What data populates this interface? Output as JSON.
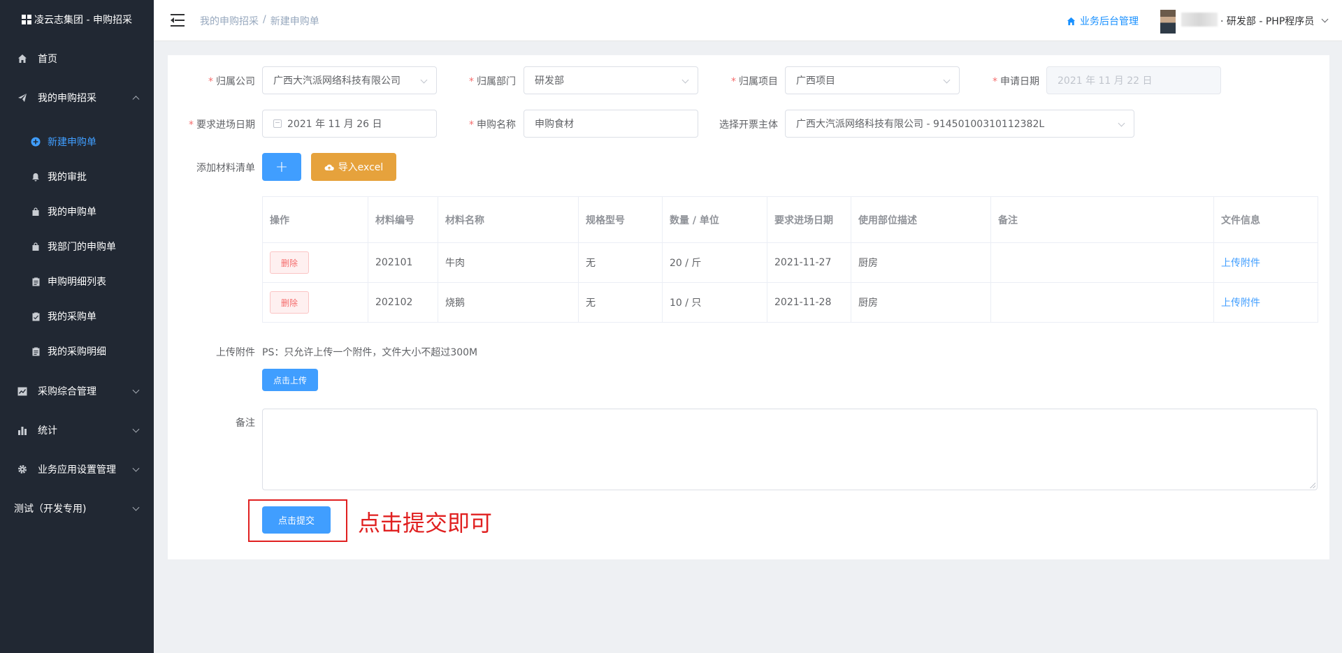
{
  "brand": {
    "title": "凌云志集团 - 申购招采"
  },
  "sidebar": {
    "home": "首页",
    "my_purchase": "我的申购招采",
    "sub_items": [
      "新建申购单",
      "我的审批",
      "我的申购单",
      "我部门的申购单",
      "申购明细列表",
      "我的采购单",
      "我的采购明细"
    ],
    "purchase_mgmt": "采购综合管理",
    "stats": "统计",
    "biz_settings": "业务应用设置管理",
    "test_dev": "测试（开发专用)"
  },
  "header": {
    "breadcrumb": [
      "我的申购招采",
      "/",
      "新建申购单"
    ],
    "biz_backend": "业务后台管理",
    "user_role": "· 研发部 - PHP程序员"
  },
  "form": {
    "company_label": "归属公司",
    "company_value": "广西大汽派网络科技有限公司",
    "dept_label": "归属部门",
    "dept_value": "研发部",
    "project_label": "归属项目",
    "project_value": "广西项目",
    "apply_date_label": "申请日期",
    "apply_date_value": "2021 年 11 月 22 日",
    "arrival_date_label": "要求进场日期",
    "arrival_date_value": "2021 年 11 月 26 日",
    "name_label": "申购名称",
    "name_value": "申购食材",
    "invoice_label": "选择开票主体",
    "invoice_value": "广西大汽派网络科技有限公司 - 91450100310112382L",
    "add_materials_label": "添加材料清单",
    "add_button": "+",
    "import_button": "导入excel",
    "upload_label": "上传附件",
    "upload_hint": "PS：只允许上传一个附件，文件大小不超过300M",
    "upload_button": "点击上传",
    "remark_label": "备注",
    "submit_button": "点击提交",
    "annotation": "点击提交即可"
  },
  "table": {
    "headers": [
      "操作",
      "材料编号",
      "材料名称",
      "规格型号",
      "数量 / 单位",
      "要求进场日期",
      "使用部位描述",
      "备注",
      "文件信息"
    ],
    "rows": [
      {
        "action": "删除",
        "code": "202101",
        "name": "牛肉",
        "spec": "无",
        "qty": "20 / 斤",
        "date": "2021-11-27",
        "location": "厨房",
        "remark": "",
        "file": "上传附件"
      },
      {
        "action": "删除",
        "code": "202102",
        "name": "烧鹅",
        "spec": "无",
        "qty": "10 / 只",
        "date": "2021-11-28",
        "location": "厨房",
        "remark": "",
        "file": "上传附件"
      }
    ]
  },
  "colors": {
    "primary": "#409eff",
    "warning": "#e6a23c",
    "danger": "#f56c6c",
    "sidebar_bg": "#212833",
    "annotation": "#e02020"
  }
}
